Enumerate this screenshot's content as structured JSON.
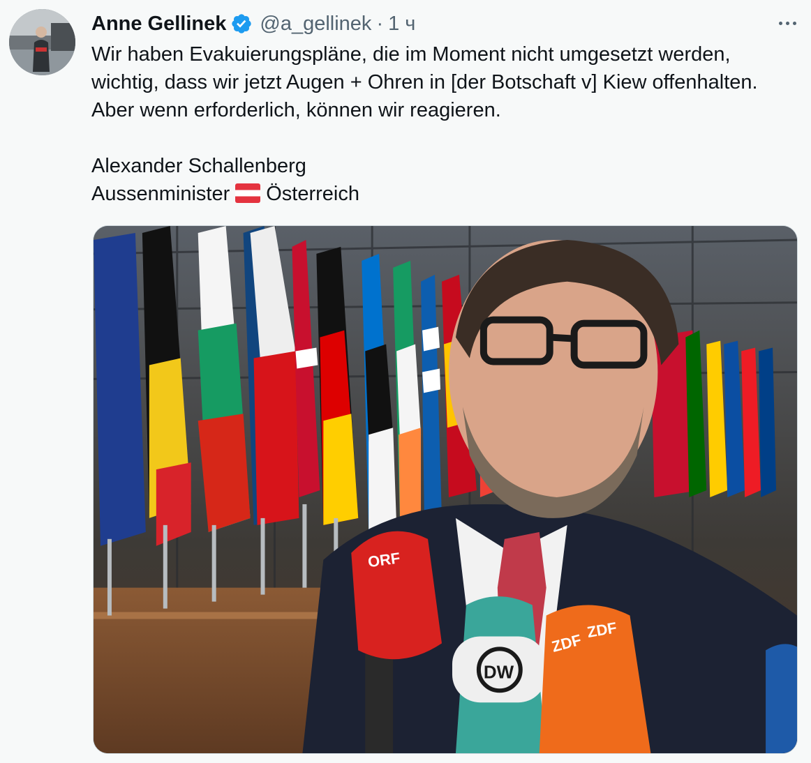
{
  "tweet": {
    "author": {
      "display_name": "Anne Gellinek",
      "handle": "@a_gellinek",
      "verified": true
    },
    "separator": "·",
    "time": "1 ч",
    "more_icon": "more-horizontal-icon",
    "lines": [
      "Wir haben Evakuierungspläne, die im Moment nicht umgesetzt werden,",
      "wichtig, dass wir jetzt Augen + Ohren in [der Botschaft v] Kiew offenhalten.",
      "Aber wenn erforderlich, können wir reagieren."
    ],
    "signature_name": "Alexander Schallenberg",
    "signature_title_before": "Aussenminister",
    "signature_flag_icon": "austria-flag-icon",
    "signature_title_after": "Österreich",
    "media": {
      "mic_labels": [
        "ORF",
        "DW",
        "ZDF",
        "ZDF"
      ]
    }
  },
  "colors": {
    "background": "#f7f9f9",
    "text": "#0f1419",
    "secondary": "#536471",
    "verified": "#1d9bf0"
  }
}
